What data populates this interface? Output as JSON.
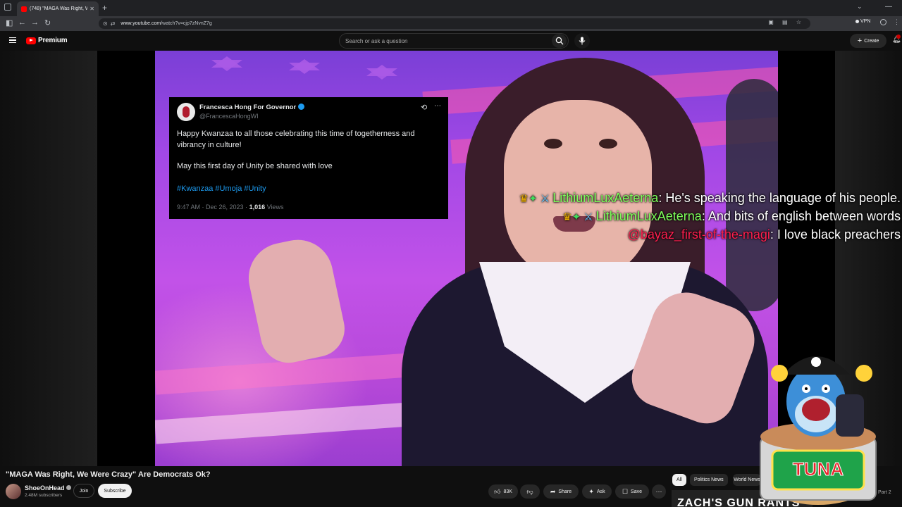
{
  "browser": {
    "tab_title": "(748) \"MAGA Was Right, We Were Crazy\" Are Democrats Ok?",
    "tab_title_short": "(748) \"MAGA Was Right, We Wa",
    "url_host": "www.youtube.com",
    "url_path": "/watch?v=cjp7zNvnZ7g",
    "vpn_label": "VPN"
  },
  "masthead": {
    "logo_text": "Premium",
    "search_placeholder": "Search or ask a question",
    "create_label": "Create"
  },
  "tweet": {
    "name": "Francesca Hong For Governor",
    "handle": "@FrancescaHongWI",
    "body_line1": "Happy Kwanzaa to all those celebrating this time of togetherness and vibrancy in culture!",
    "body_line2": "May this first day of Unity be shared with love",
    "hashtags": "#Kwanzaa #Umoja #Unity",
    "timestamp": "9:47 AM · Dec 26, 2023 · ",
    "views_count": "1,016",
    "views_label": " Views"
  },
  "chat": [
    {
      "user": "LithiumLuxAeterna",
      "message": ": He's speaking the language of his people.",
      "color": "#7dff5a",
      "badges": true
    },
    {
      "user": "LithiumLuxAeterna",
      "message": ": And bits of english between words",
      "color": "#7dff5a",
      "badges": true
    },
    {
      "user": "@bayaz_first-of-the-magi",
      "message": ": I love black preachers",
      "color": "#ff1f4f",
      "badges": false
    }
  ],
  "mascot": {
    "label": "TUNA"
  },
  "video": {
    "title": "\"MAGA Was Right, We Were Crazy\" Are Democrats Ok?",
    "channel_name": "ShoeOnHead",
    "subscribers": "2.48M subscribers",
    "join_label": "Join",
    "subscribe_label": "Subscribe",
    "like_count": "83K",
    "share_label": "Share",
    "ask_label": "Ask",
    "save_label": "Save"
  },
  "chips": [
    "All",
    "Politics News",
    "World News"
  ],
  "recommendation": {
    "thumb_text": "ZACH'S GUN RANTS",
    "part_label": "Part 2"
  }
}
